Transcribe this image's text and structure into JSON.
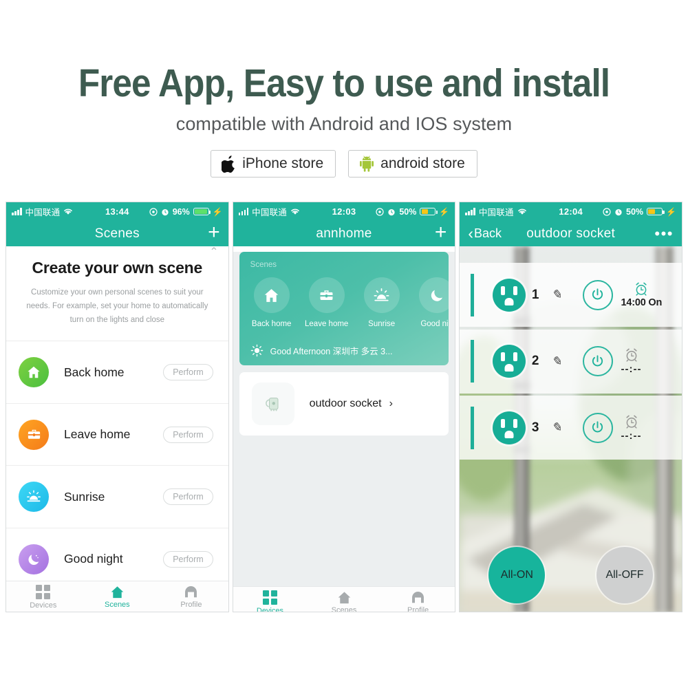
{
  "promo": {
    "title": "Free App, Easy to use and install",
    "subtitle": "compatible with Android and IOS system",
    "buttons": [
      {
        "label": "iPhone store",
        "icon": "apple-icon"
      },
      {
        "label": "android store",
        "icon": "android-icon"
      }
    ],
    "title_color": "#3e5b50"
  },
  "theme": {
    "teal": "#20b39c",
    "teal_dark": "#17ad96",
    "battery_green": "#5ee06b",
    "battery_yellow": "#f5c518"
  },
  "phone1": {
    "status": {
      "carrier": "中国联通",
      "time": "13:44",
      "battery_pct": "96%",
      "battery_color": "#5ee06b",
      "icons": [
        "signal-bars-icon",
        "wifi-icon",
        "location-icon",
        "alarm-icon",
        "battery-icon",
        "charging-bolt-icon"
      ]
    },
    "nav": {
      "title": "Scenes",
      "add_label": "+"
    },
    "hero": {
      "heading": "Create your own scene",
      "body": "Customize your own personal scenes to suit your needs. For example, set your home to automatically turn on the lights and close"
    },
    "scenes": [
      {
        "label": "Back home",
        "action": "Perform",
        "icon": "home-icon",
        "color1": "#7ed141",
        "color2": "#4bbf3f"
      },
      {
        "label": "Leave home",
        "action": "Perform",
        "icon": "briefcase-icon",
        "color1": "#ffa522",
        "color2": "#f47b1a"
      },
      {
        "label": "Sunrise",
        "action": "Perform",
        "icon": "sunrise-icon",
        "color1": "#3ed8f5",
        "color2": "#1cb9e8"
      },
      {
        "label": "Good night",
        "action": "Perform",
        "icon": "moon-icon",
        "color1": "#c39bec",
        "color2": "#a471e0"
      }
    ],
    "tabs": [
      {
        "label": "Devices",
        "icon": "grid-icon",
        "active": false
      },
      {
        "label": "Scenes",
        "icon": "home-icon",
        "active": true
      },
      {
        "label": "Profile",
        "icon": "profile-icon",
        "active": false
      }
    ]
  },
  "phone2": {
    "status": {
      "carrier": "中国联通",
      "time": "12:03",
      "battery_pct": "50%",
      "battery_color": "#f5c518"
    },
    "nav": {
      "title": "annhome",
      "add_label": "+"
    },
    "scene_card": {
      "title": "Scenes",
      "items": [
        {
          "label": "Back home",
          "icon": "home-icon"
        },
        {
          "label": "Leave home",
          "icon": "briefcase-icon"
        },
        {
          "label": "Sunrise",
          "icon": "sunrise-icon"
        },
        {
          "label": "Good nig",
          "icon": "moon-icon"
        }
      ],
      "weather": "Good Afternoon 深圳市 多云 3...",
      "weather_icon": "sun-icon"
    },
    "device": {
      "name": "outdoor socket",
      "chevron": "›",
      "icon": "socket-device-icon"
    },
    "tabs": [
      {
        "label": "Devices",
        "icon": "grid-icon",
        "active": true
      },
      {
        "label": "Scenes",
        "icon": "home-icon",
        "active": false
      },
      {
        "label": "Profile",
        "icon": "profile-icon",
        "active": false
      }
    ]
  },
  "phone3": {
    "status": {
      "carrier": "中国联通",
      "time": "12:04",
      "battery_pct": "50%",
      "battery_color": "#f5c518"
    },
    "nav": {
      "back_label": "Back",
      "title": "outdoor socket",
      "more": "•••"
    },
    "sockets": [
      {
        "number": "1",
        "timer": "14:00 On",
        "timer_set": true,
        "pen": "✎",
        "power_icon": "power-icon",
        "alarm_icon": "alarm-clock-icon"
      },
      {
        "number": "2",
        "timer": "--:--",
        "timer_set": false,
        "pen": "✎",
        "power_icon": "power-icon",
        "alarm_icon": "alarm-clock-icon"
      },
      {
        "number": "3",
        "timer": "--:--",
        "timer_set": false,
        "pen": "✎",
        "power_icon": "power-icon",
        "alarm_icon": "alarm-clock-icon"
      }
    ],
    "all_buttons": [
      {
        "label": "All-ON",
        "state": "on"
      },
      {
        "label": "All-OFF",
        "state": "off"
      }
    ]
  }
}
